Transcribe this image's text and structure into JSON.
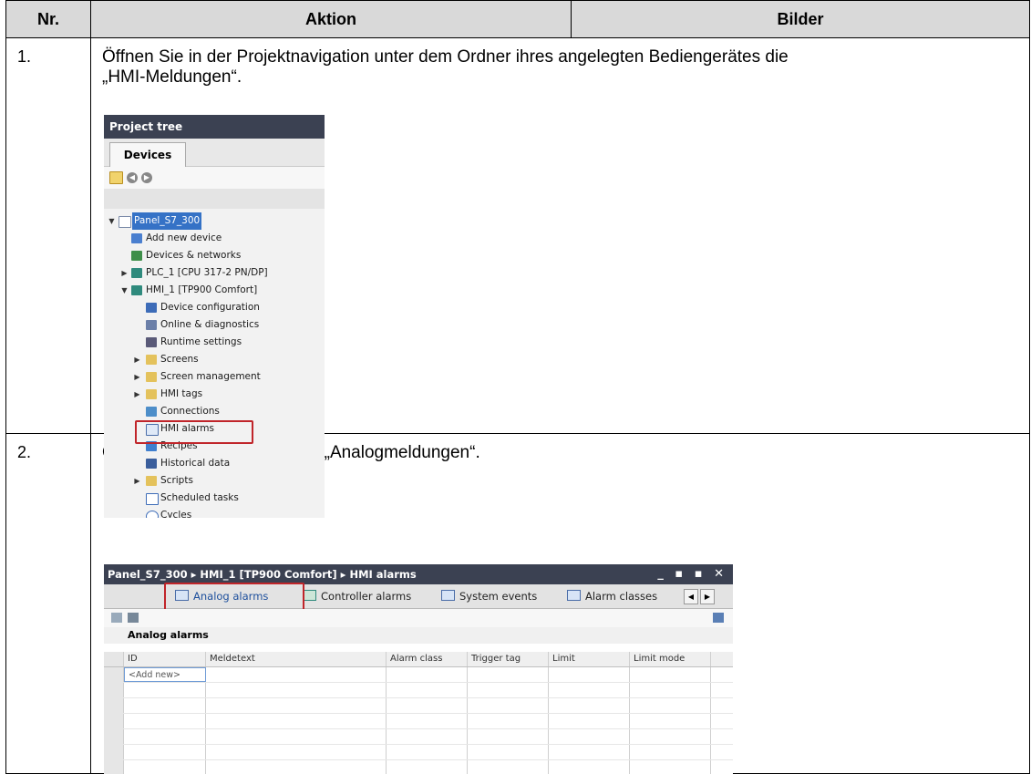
{
  "table": {
    "headers": {
      "nr": "Nr.",
      "aktion": "Aktion",
      "bilder": "Bilder"
    },
    "rows": [
      {
        "nr": "1.",
        "text": "Öffnen Sie in der Projektnavigation unter dem Ordner ihres angelegten Bediengerätes die\n„HMI-Meldungen“."
      },
      {
        "nr": "2.",
        "text": "Öffnen Sie die Registerkarte „Analogmeldungen“."
      }
    ]
  },
  "project_tree": {
    "title": "Project tree",
    "tab": "Devices",
    "items": [
      {
        "label": "Panel_S7_300",
        "icon": "project-icon",
        "expander": "▼",
        "selected": true
      },
      {
        "label": "Add new device",
        "icon": "add-device-icon"
      },
      {
        "label": "Devices & networks",
        "icon": "network-icon"
      },
      {
        "label": "PLC_1 [CPU 317-2 PN/DP]",
        "icon": "plc-icon",
        "expander": "▶"
      },
      {
        "label": "HMI_1 [TP900 Comfort]",
        "icon": "hmi-icon",
        "expander": "▼"
      },
      {
        "label": "Device configuration",
        "icon": "device-config-icon"
      },
      {
        "label": "Online & diagnostics",
        "icon": "diagnostics-icon"
      },
      {
        "label": "Runtime settings",
        "icon": "runtime-icon"
      },
      {
        "label": "Screens",
        "icon": "folder-icon",
        "expander": "▶"
      },
      {
        "label": "Screen management",
        "icon": "screen-management-icon",
        "expander": "▶"
      },
      {
        "label": "HMI tags",
        "icon": "tags-icon",
        "expander": "▶"
      },
      {
        "label": "Connections",
        "icon": "connections-icon"
      },
      {
        "label": "HMI alarms",
        "icon": "envelope-icon",
        "highlighted": true
      },
      {
        "label": "Recipes",
        "icon": "recipes-icon"
      },
      {
        "label": "Historical data",
        "icon": "historical-icon"
      },
      {
        "label": "Scripts",
        "icon": "scripts-icon",
        "expander": "▶"
      },
      {
        "label": "Scheduled tasks",
        "icon": "scheduled-icon"
      },
      {
        "label": "Cycles",
        "icon": "cycles-icon"
      }
    ]
  },
  "alarms_window": {
    "breadcrumb": "Panel_S7_300  ▸  HMI_1 [TP900 Comfort]  ▸  HMI alarms",
    "window_buttons": "_ ▪ ▪ ✕",
    "tabs": [
      "Analog alarms",
      "Controller alarms",
      "System events",
      "Alarm classes"
    ],
    "section_title": "Analog alarms",
    "columns": [
      "ID",
      "Meldetext",
      "Alarm class",
      "Trigger tag",
      "Limit",
      "Limit mode"
    ],
    "add_new": "<Add new>"
  },
  "colors": {
    "title_bar": "#3b4152",
    "header_bg": "#d9d9d9",
    "highlight": "#c0252a",
    "selection": "#3572c6"
  }
}
